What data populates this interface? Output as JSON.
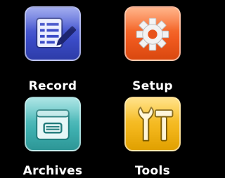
{
  "menu": {
    "items": [
      {
        "label": "Record",
        "icon": "record-list-pen-icon",
        "color": "#3b4cc8"
      },
      {
        "label": "Setup",
        "icon": "gear-icon",
        "color": "#f05a1f"
      },
      {
        "label": "Archives",
        "icon": "archive-box-icon",
        "color": "#3fb0b0"
      },
      {
        "label": "Tools",
        "icon": "wrench-hammer-icon",
        "color": "#f2b51a"
      }
    ]
  }
}
